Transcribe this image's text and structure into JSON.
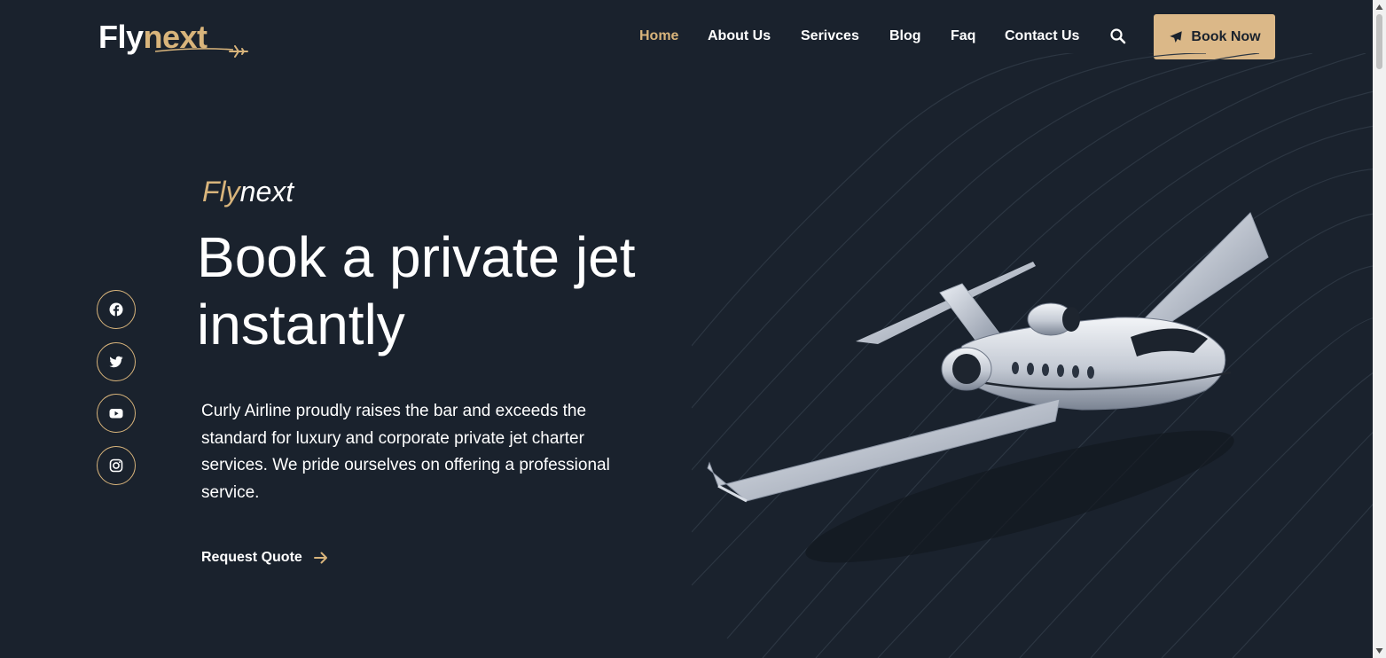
{
  "brand": {
    "logo_part1": "Fly",
    "logo_part2": "next",
    "accent_color": "#d8b47b",
    "background_color": "#1a222d"
  },
  "nav": {
    "items": [
      {
        "label": "Home",
        "active": true
      },
      {
        "label": "About Us",
        "active": false
      },
      {
        "label": "Serivces",
        "active": false
      },
      {
        "label": "Blog",
        "active": false
      },
      {
        "label": "Faq",
        "active": false
      },
      {
        "label": "Contact Us",
        "active": false
      }
    ],
    "search_icon": "search-icon",
    "cta_label": "Book Now",
    "cta_icon": "plane-icon"
  },
  "hero": {
    "eyebrow_part1": "Fly",
    "eyebrow_part2": "next",
    "headline_line1": "Book a private jet",
    "headline_line2": "instantly",
    "description": "Curly Airline proudly raises the bar and exceeds the standard for luxury and corporate private jet charter services. We pride ourselves on offering a professional service.",
    "cta_label": "Request Quote",
    "cta_icon": "arrow-right-icon"
  },
  "social": {
    "items": [
      "facebook-icon",
      "twitter-icon",
      "youtube-icon",
      "instagram-icon"
    ]
  }
}
